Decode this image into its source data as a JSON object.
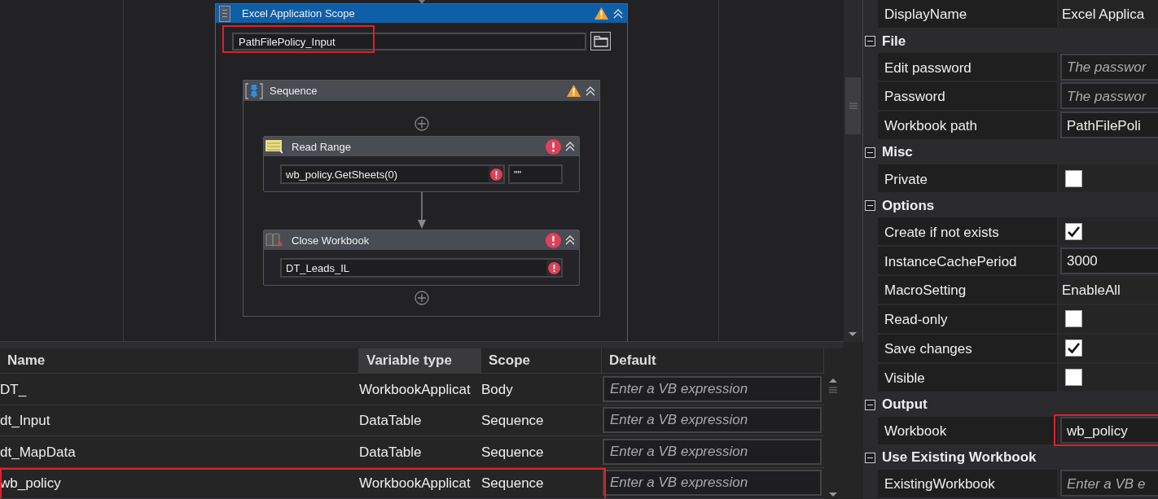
{
  "designer": {
    "scope": {
      "title": "Excel Application Scope",
      "warning": true,
      "path": {
        "value": "PathFilePolicy_Input",
        "highlighted": true
      },
      "sequence": {
        "title": "Sequence",
        "warning": true,
        "activities": [
          {
            "kind": "read_range",
            "title": "Read Range",
            "error": true,
            "fields": [
              {
                "value": "wb_policy.GetSheets(0)",
                "error": true
              },
              {
                "value": "\"\"",
                "error": false
              }
            ]
          },
          {
            "kind": "close_workbook",
            "title": "Close Workbook",
            "error": true,
            "fields": [
              {
                "value": "DT_Leads_IL",
                "error": true
              }
            ]
          }
        ]
      }
    }
  },
  "variables": {
    "columns": [
      {
        "label": "Name",
        "hovered": false
      },
      {
        "label": "Variable type",
        "hovered": true
      },
      {
        "label": "Scope",
        "hovered": false
      },
      {
        "label": "Default",
        "hovered": false
      }
    ],
    "rows": [
      {
        "name": "DT_",
        "type": "WorkbookApplicat",
        "scope": "Body",
        "default": "Enter a VB expression",
        "highlighted": false
      },
      {
        "name": "dt_Input",
        "type": "DataTable",
        "scope": "Sequence",
        "default": "Enter a VB expression",
        "highlighted": false
      },
      {
        "name": "dt_MapData",
        "type": "DataTable",
        "scope": "Sequence",
        "default": "Enter a VB expression",
        "highlighted": false
      },
      {
        "name": "wb_policy",
        "type": "WorkbookApplicat",
        "scope": "Sequence",
        "default": "Enter a VB expression",
        "highlighted": true
      }
    ]
  },
  "properties": {
    "top_rows": [
      {
        "kind": "text",
        "label": "DisplayName",
        "value": "Excel Applica"
      }
    ],
    "sections": [
      {
        "title": "File",
        "expanded": true,
        "rows": [
          {
            "kind": "placeholder",
            "label": "Edit password",
            "value": "The passwor"
          },
          {
            "kind": "placeholder",
            "label": "Password",
            "value": "The passwor"
          },
          {
            "kind": "field",
            "label": "Workbook path",
            "value": "PathFilePoli"
          }
        ]
      },
      {
        "title": "Misc",
        "expanded": true,
        "rows": [
          {
            "kind": "checkbox",
            "label": "Private",
            "checked": false
          }
        ]
      },
      {
        "title": "Options",
        "expanded": true,
        "rows": [
          {
            "kind": "checkbox",
            "label": "Create if not exists",
            "checked": true
          },
          {
            "kind": "field",
            "label": "InstanceCachePeriod",
            "value": "3000"
          },
          {
            "kind": "text",
            "label": "MacroSetting",
            "value": "EnableAll"
          },
          {
            "kind": "checkbox",
            "label": "Read-only",
            "checked": false
          },
          {
            "kind": "checkbox",
            "label": "Save changes",
            "checked": true
          },
          {
            "kind": "checkbox",
            "label": "Visible",
            "checked": false
          }
        ]
      },
      {
        "title": "Output",
        "expanded": true,
        "rows": [
          {
            "kind": "field",
            "label": "Workbook",
            "value": "wb_policy",
            "highlighted": true
          }
        ]
      },
      {
        "title": "Use Existing Workbook",
        "expanded": true,
        "rows": [
          {
            "kind": "placeholder",
            "label": "ExistingWorkbook",
            "value": "Enter a VB e"
          }
        ]
      }
    ]
  }
}
